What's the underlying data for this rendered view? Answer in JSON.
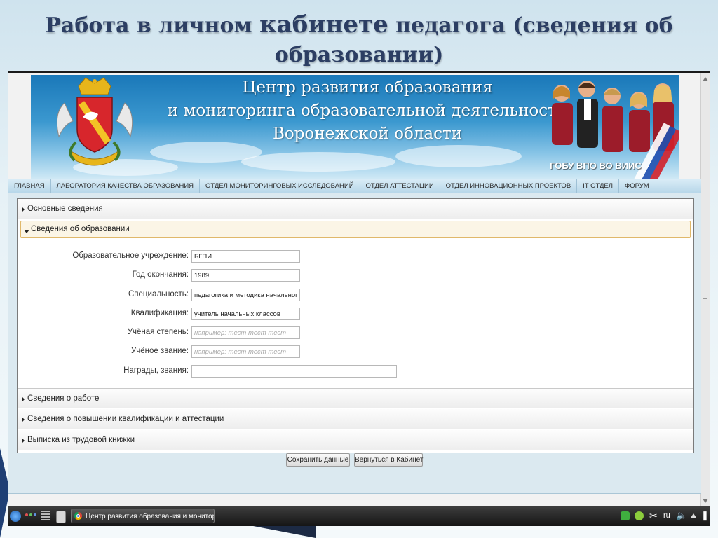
{
  "slide": {
    "title_part1": "Работа в личном ",
    "title_big": "кабинете",
    "title_part2": " педагога (сведения об",
    "title_line2": "образовании)"
  },
  "banner": {
    "line1": "Центр развития образования",
    "line2": "и мониторинга образовательной деятельности",
    "line3": "Воронежской области",
    "footer": "ГОБУ ВПО ВО ВИИС"
  },
  "nav": [
    "ГЛАВНАЯ",
    "ЛАБОРАТОРИЯ КАЧЕСТВА ОБРАЗОВАНИЯ",
    "ОТДЕЛ МОНИТОРИНГОВЫХ ИССЛЕДОВАНИЙ",
    "ОТДЕЛ АТТЕСТАЦИИ",
    "ОТДЕЛ ИННОВАЦИОННЫХ ПРОЕКТОВ",
    "IT ОТДЕЛ",
    "ФОРУМ"
  ],
  "sections": {
    "basic": "Основные сведения",
    "education": "Сведения об образовании",
    "work": "Сведения о работе",
    "qualification": "Сведения о повышении квалификации и аттестации",
    "workbook": "Выписка из трудовой книжки"
  },
  "form": {
    "institution": {
      "label": "Образовательное учреждение:",
      "value": "БГПИ"
    },
    "year": {
      "label": "Год окончания:",
      "value": "1989"
    },
    "specialty": {
      "label": "Специальность:",
      "value": "педагогика и методика начального с"
    },
    "qualification": {
      "label": "Квалификация:",
      "value": "учитель начальных классов"
    },
    "degree": {
      "label": "Учёная степень:",
      "value": "",
      "placeholder": "например: тест тест тест"
    },
    "title": {
      "label": "Учёное звание:",
      "value": "",
      "placeholder": "например: тест тест тест"
    },
    "awards": {
      "label": "Награды, звания:",
      "value": ""
    }
  },
  "buttons": {
    "save": "Сохранить данные",
    "back": "Вернуться в Кабинет"
  },
  "taskbar": {
    "task": "Центр развития образования и мониторинга",
    "lang": "ru"
  },
  "colors": {
    "title": "#2c3e63",
    "banner": "#1a78b9",
    "nav": "#c9e2f0",
    "open_section_border": "#e0b86a"
  }
}
